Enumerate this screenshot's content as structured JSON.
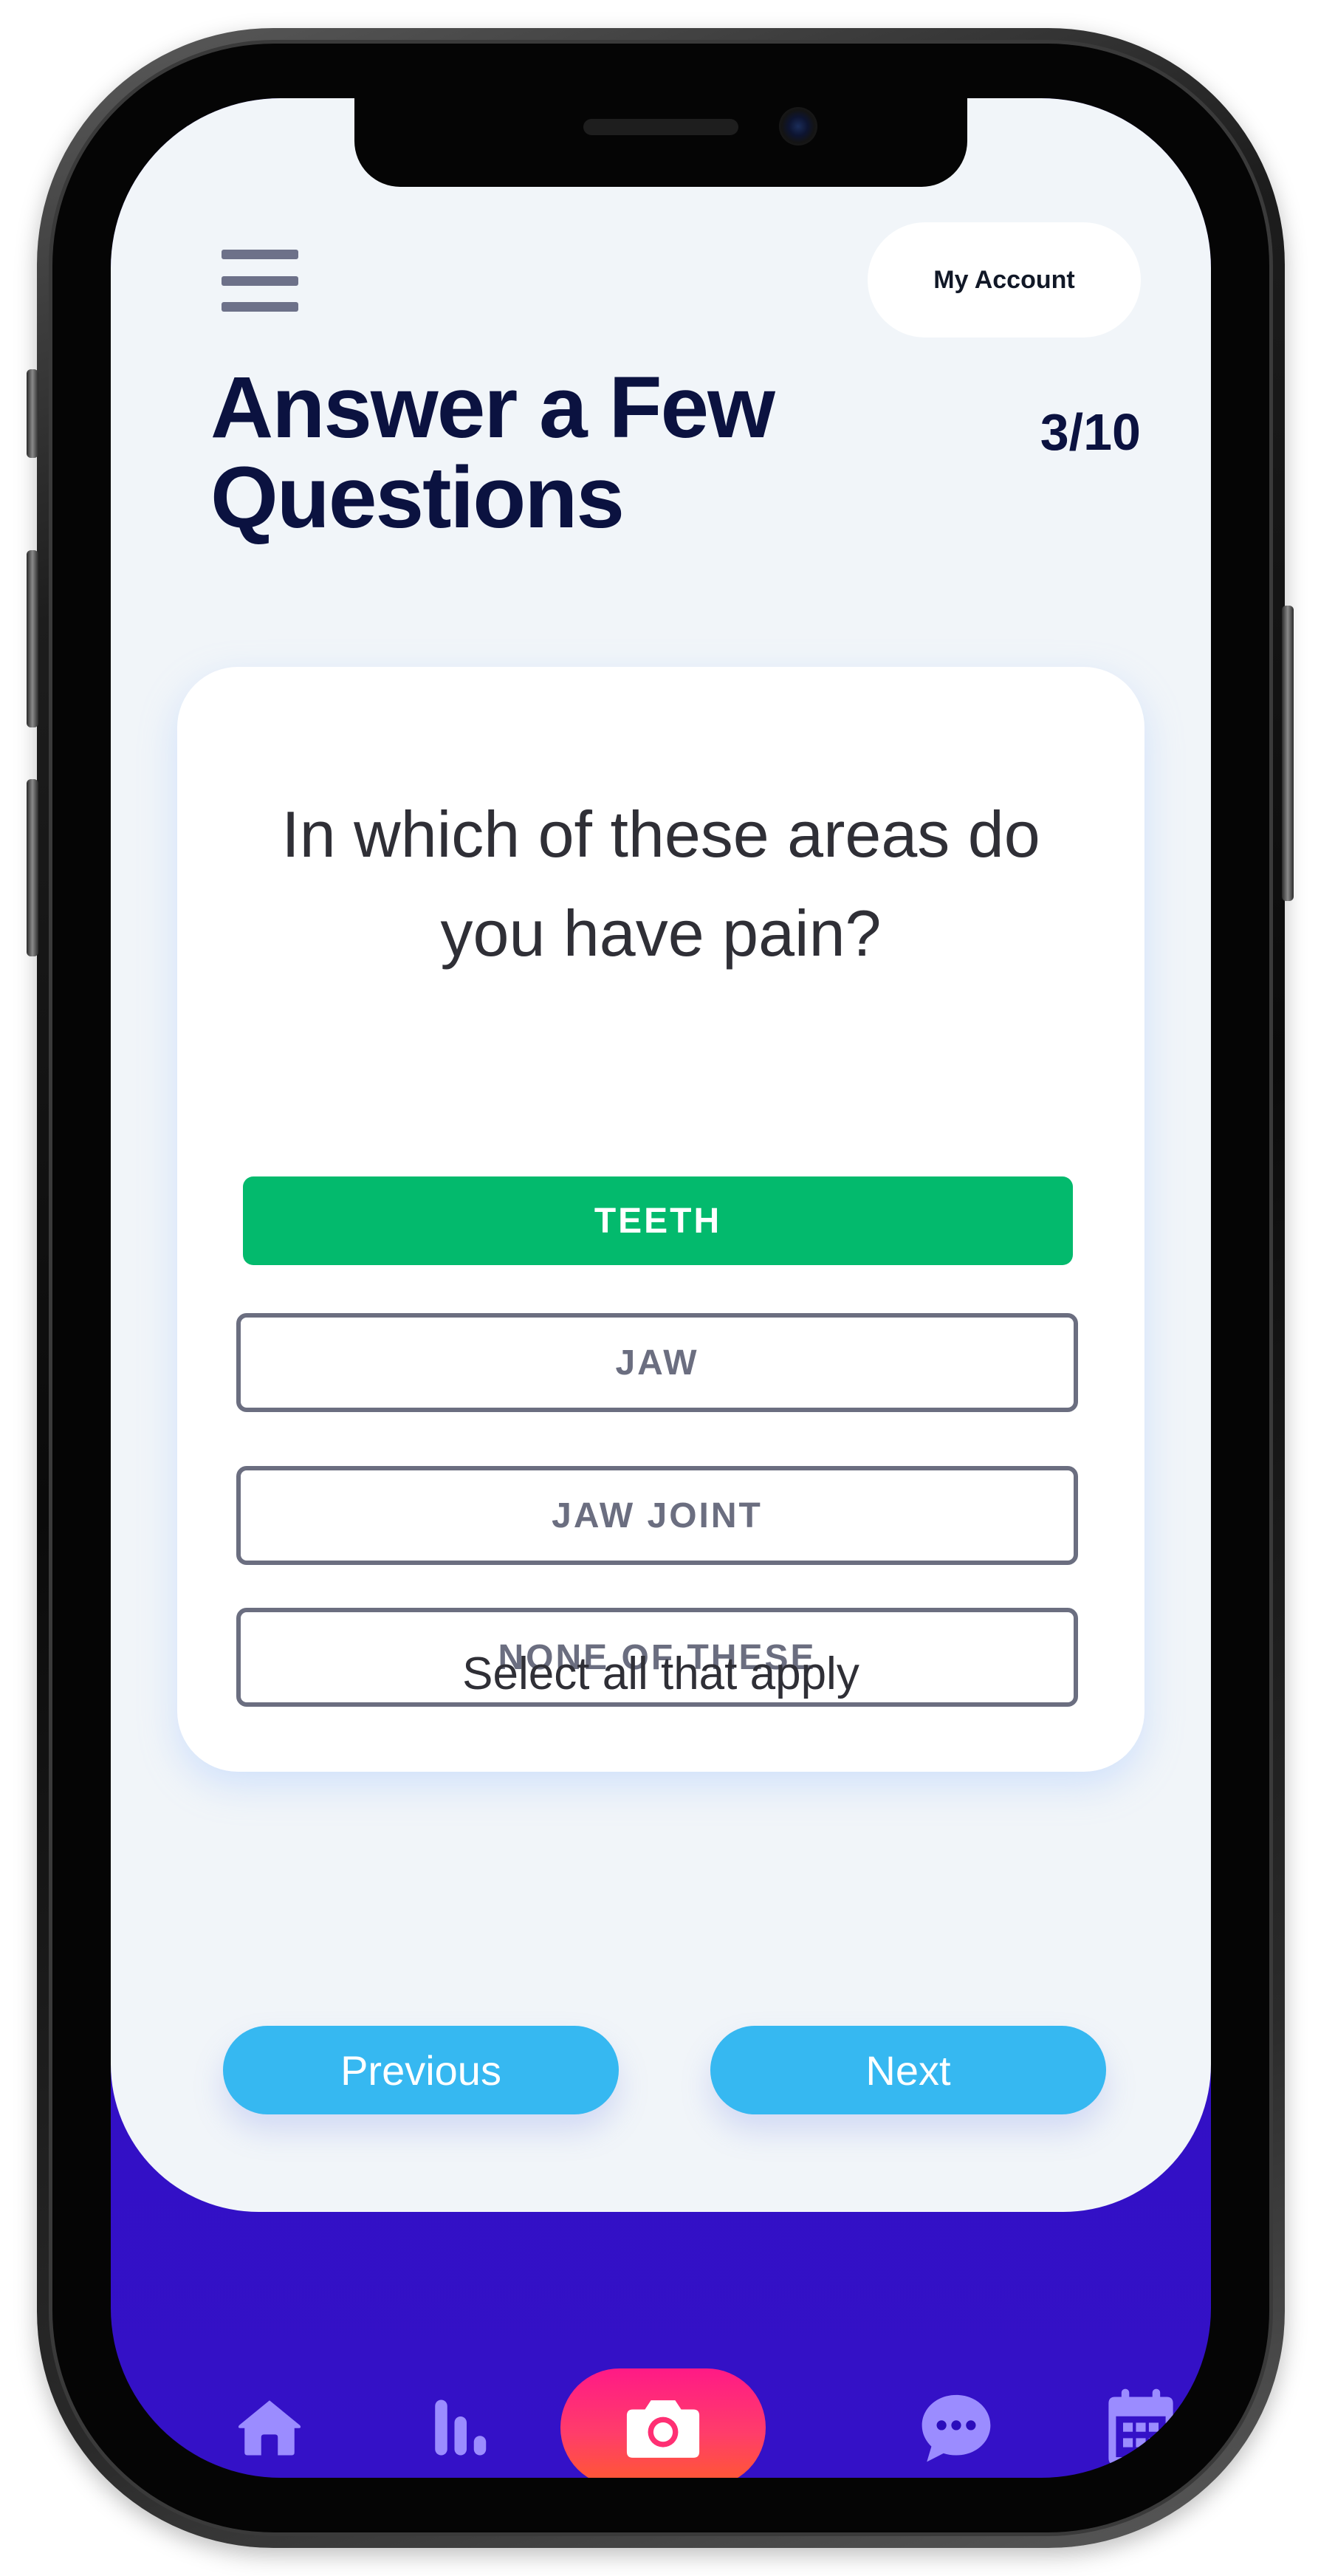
{
  "header": {
    "account_label": "My Account",
    "title": "Answer a Few Questions",
    "step": "3/10"
  },
  "card": {
    "question": "In which of these areas do you have pain?",
    "options": [
      {
        "label": "TEETH",
        "selected": true
      },
      {
        "label": "JAW",
        "selected": false
      },
      {
        "label": "JAW JOINT",
        "selected": false
      },
      {
        "label": "NONE OF THESE",
        "selected": false
      }
    ],
    "hint": "Select all that apply"
  },
  "navigation": {
    "previous_label": "Previous",
    "next_label": "Next"
  },
  "tabbar": {
    "items": [
      {
        "icon": "home-icon"
      },
      {
        "icon": "stats-icon"
      },
      {
        "icon": "camera-icon",
        "active": true
      },
      {
        "icon": "chat-icon"
      },
      {
        "icon": "calendar-icon"
      }
    ]
  },
  "colors": {
    "selected_option": "#03ba6d",
    "option_outline": "#6b6e80",
    "nav_button": "#36b8f1",
    "tabbar_background": "#2b0dbb",
    "tab_icon": "#9b8cff",
    "camera_gradient_start": "#ff1a86",
    "camera_gradient_end": "#ff5a2e",
    "title_text": "#0b1240",
    "screen_background": "#f1f5f9"
  }
}
